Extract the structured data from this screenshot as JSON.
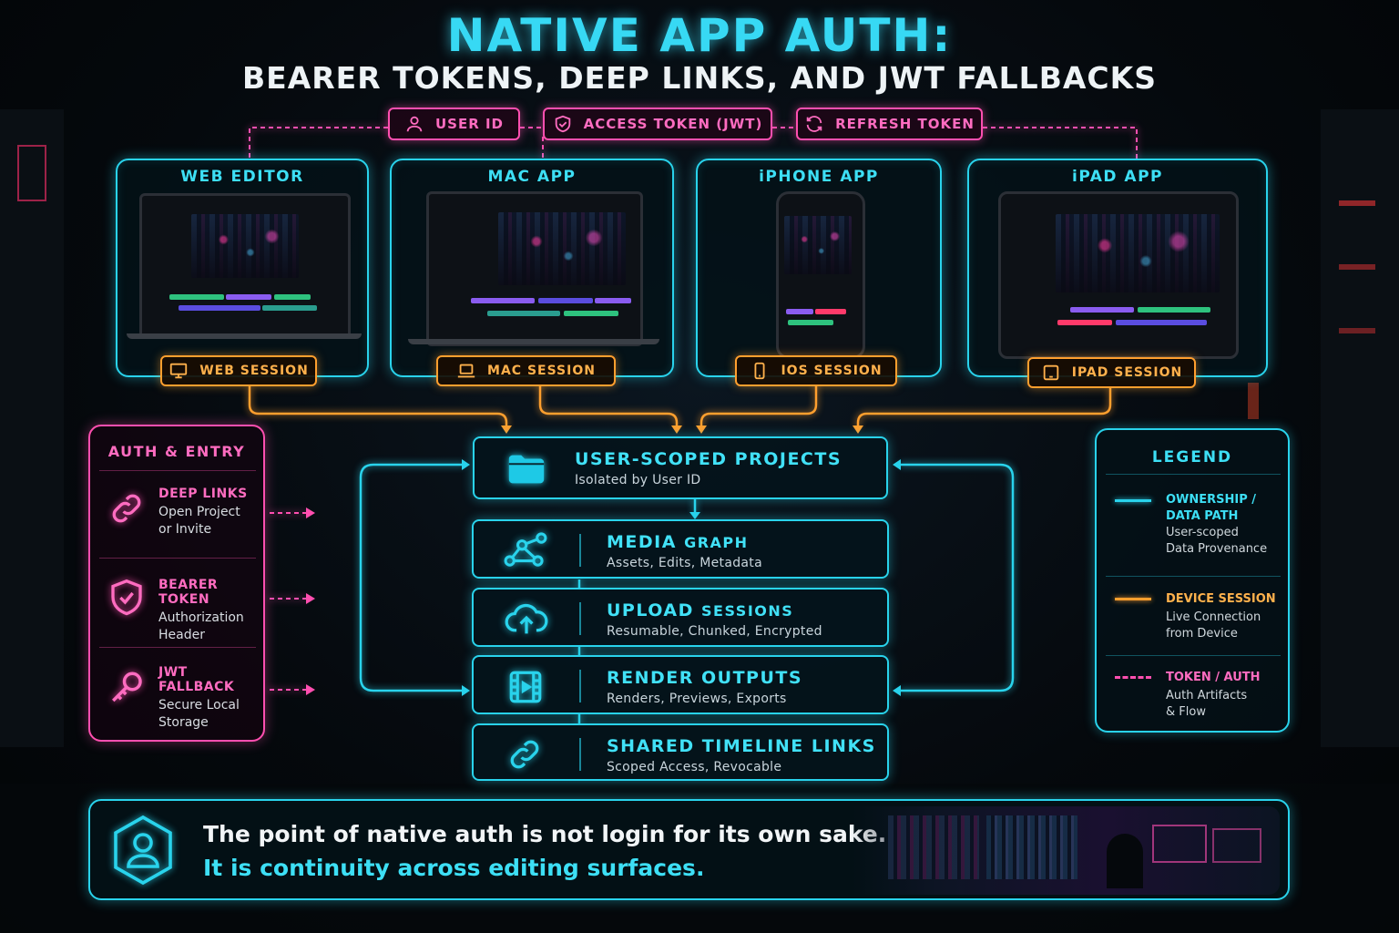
{
  "title": "NATIVE APP AUTH:",
  "subtitle": "BEARER TOKENS, DEEP LINKS, AND JWT FALLBACKS",
  "tokens": [
    {
      "label": "USER ID",
      "icon": "user-icon"
    },
    {
      "label": "ACCESS TOKEN (JWT)",
      "icon": "shield-check-icon"
    },
    {
      "label": "REFRESH TOKEN",
      "icon": "refresh-icon"
    }
  ],
  "devices": [
    {
      "title": "WEB EDITOR",
      "session": "WEB SESSION",
      "icon": "monitor-icon"
    },
    {
      "title": "MAC APP",
      "session": "MAC SESSION",
      "icon": "laptop-icon"
    },
    {
      "title": "iPHONE APP",
      "session": "IOS SESSION",
      "icon": "phone-icon"
    },
    {
      "title": "iPAD APP",
      "session": "IPAD SESSION",
      "icon": "tablet-icon"
    }
  ],
  "auth_entry": {
    "title": "AUTH & ENTRY",
    "items": [
      {
        "title": "DEEP LINKS",
        "desc1": "Open Project",
        "desc2": "or Invite",
        "icon": "link-icon"
      },
      {
        "title": "BEARER TOKEN",
        "desc1": "Authorization",
        "desc2": "Header",
        "icon": "shield-check-icon"
      },
      {
        "title": "JWT FALLBACK",
        "desc1": "Secure Local",
        "desc2": "Storage",
        "icon": "key-icon"
      }
    ]
  },
  "hub": {
    "projects": {
      "title": "USER-SCOPED PROJECTS",
      "desc": "Isolated by User ID",
      "icon": "folder-icon"
    },
    "modules": [
      {
        "title_a": "MEDIA",
        "title_b": "GRAPH",
        "desc": "Assets, Edits, Metadata",
        "icon": "graph-icon"
      },
      {
        "title_a": "UPLOAD",
        "title_b": "SESSIONS",
        "desc": "Resumable, Chunked, Encrypted",
        "icon": "cloud-upload-icon"
      },
      {
        "title_a": "RENDER OUTPUTS",
        "title_b": "",
        "desc": "Renders, Previews, Exports",
        "icon": "film-icon"
      },
      {
        "title_a": "SHARED TIMELINE LINKS",
        "title_b": "",
        "desc": "Scoped Access, Revocable",
        "icon": "link-icon"
      }
    ]
  },
  "legend": {
    "title": "LEGEND",
    "items": [
      {
        "t1": "OWNERSHIP /",
        "t2": "DATA PATH",
        "d1": "User-scoped",
        "d2": "Data Provenance",
        "color": "#29d3ec",
        "style": "solid"
      },
      {
        "t1": "DEVICE SESSION",
        "t2": "",
        "d1": "Live Connection",
        "d2": "from Device",
        "color": "#ff9f2e",
        "style": "solid"
      },
      {
        "t1": "TOKEN / AUTH",
        "t2": "",
        "d1": "Auth Artifacts",
        "d2": "& Flow",
        "color": "#ff4fb0",
        "style": "dashed"
      }
    ]
  },
  "footer": {
    "line1": "The point of native auth is not login for its own sake.",
    "line2": "It is continuity across editing surfaces.",
    "icon": "user-hexagon-icon"
  },
  "colors": {
    "cyan": "#29d3ec",
    "magenta": "#ff4fb0",
    "orange": "#ff9f2e"
  }
}
